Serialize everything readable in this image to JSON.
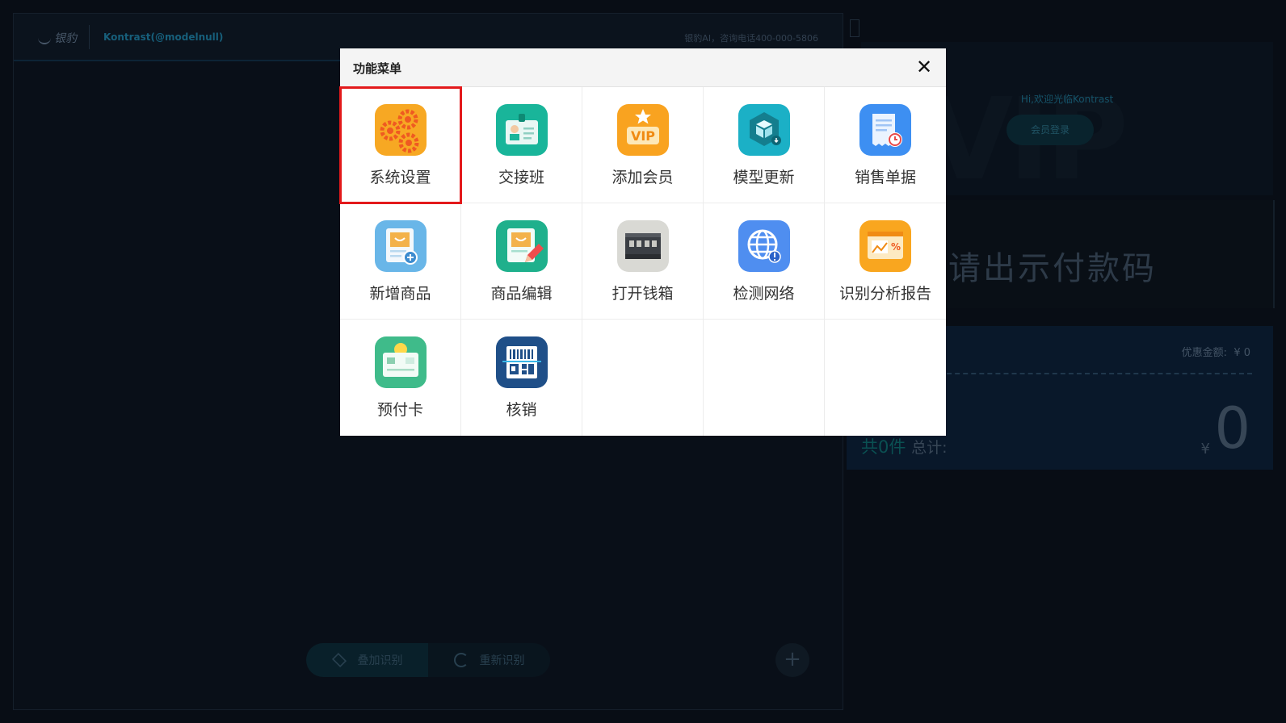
{
  "header": {
    "logo_text": "银豹",
    "user": "Kontrast(@modelnull)",
    "hotline": "银豹AI，咨询电话400-000-5806"
  },
  "bottom": {
    "stack_label": "叠加识别",
    "rescan_label": "重新识别",
    "plus_label": "+"
  },
  "right": {
    "welcome": "Hi,欢迎光临Kontrast",
    "login": "会员登录",
    "big_watermark": "VIP",
    "pay_prompt": "请出示付款码",
    "discount_label": "优惠金额:",
    "discount_value": "¥ 0",
    "count_prefix": "共0件",
    "total_label": "总计:",
    "currency": "¥",
    "total": "0"
  },
  "modal": {
    "title": "功能菜单",
    "close": "✕",
    "items": [
      {
        "label": "系统设置",
        "icon": "gears-icon",
        "selected": true
      },
      {
        "label": "交接班",
        "icon": "id-badge-icon"
      },
      {
        "label": "添加会员",
        "icon": "vip-icon"
      },
      {
        "label": "模型更新",
        "icon": "cube-update-icon"
      },
      {
        "label": "销售单据",
        "icon": "receipt-clock-icon"
      },
      {
        "label": "新增商品",
        "icon": "add-product-icon"
      },
      {
        "label": "商品编辑",
        "icon": "edit-product-icon"
      },
      {
        "label": "打开钱箱",
        "icon": "cash-drawer-icon"
      },
      {
        "label": "检测网络",
        "icon": "network-check-icon"
      },
      {
        "label": "识别分析报告",
        "icon": "analysis-report-icon"
      },
      {
        "label": "预付卡",
        "icon": "prepaid-card-icon"
      },
      {
        "label": "核销",
        "icon": "qr-scan-icon"
      }
    ]
  }
}
